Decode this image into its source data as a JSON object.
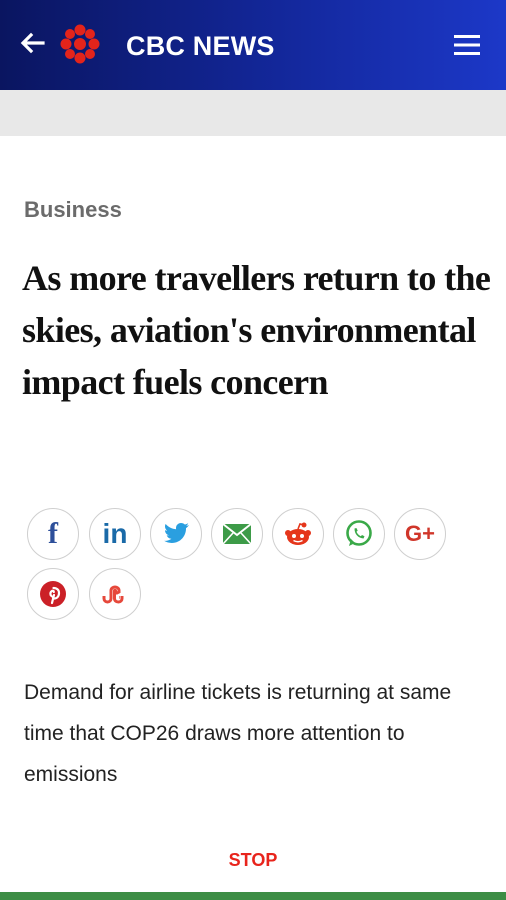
{
  "header": {
    "brand": "CBC NEWS",
    "back_icon": "back-arrow-icon",
    "logo_icon": "cbc-gem-logo",
    "menu_icon": "hamburger-menu-icon",
    "colors": {
      "gradient_start": "#0a1560",
      "gradient_end": "#1c38c8"
    }
  },
  "article": {
    "category": "Business",
    "headline": "As more travellers return to the skies, aviation's environmental impact fuels concern",
    "summary": "Demand for airline tickets is returning at same time that COP26 draws more attention to emissions"
  },
  "share": {
    "buttons": [
      {
        "id": "facebook",
        "icon": "facebook-icon",
        "glyph": "f"
      },
      {
        "id": "linkedin",
        "icon": "linkedin-icon",
        "glyph": "in"
      },
      {
        "id": "twitter",
        "icon": "twitter-icon"
      },
      {
        "id": "email",
        "icon": "email-icon"
      },
      {
        "id": "reddit",
        "icon": "reddit-icon"
      },
      {
        "id": "whatsapp",
        "icon": "whatsapp-icon"
      },
      {
        "id": "googleplus",
        "icon": "google-plus-icon",
        "glyph": "G+"
      },
      {
        "id": "pinterest",
        "icon": "pinterest-icon"
      },
      {
        "id": "stumbleupon",
        "icon": "stumbleupon-icon"
      }
    ]
  },
  "player": {
    "stop_label": "STOP"
  },
  "colors": {
    "stop": "#e8241c",
    "bottom_bar": "#3d8d45"
  }
}
